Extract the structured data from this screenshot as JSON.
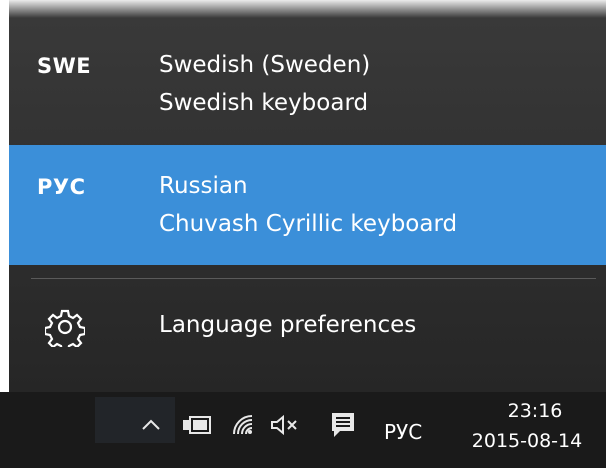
{
  "language_list": [
    {
      "code": "SWE",
      "language": "Swedish (Sweden)",
      "keyboard": "Swedish keyboard",
      "selected": false
    },
    {
      "code": "РУС",
      "language": "Russian",
      "keyboard": "Chuvash Cyrillic keyboard",
      "selected": true
    }
  ],
  "preferences": {
    "label": "Language preferences",
    "icon": "gear-icon"
  },
  "colors": {
    "flyout_bg": "#2b2b2b",
    "selected_bg": "#3b8fd9",
    "taskbar_bg": "#1a1a1a",
    "text": "#ffffff"
  },
  "taskbar": {
    "icons": [
      "chevron-up-icon",
      "power-plug-icon",
      "wifi-icon",
      "volume-muted-icon",
      "action-center-icon"
    ],
    "input_indicator": "РУС",
    "time": "23:16",
    "date": "2015-08-14"
  }
}
